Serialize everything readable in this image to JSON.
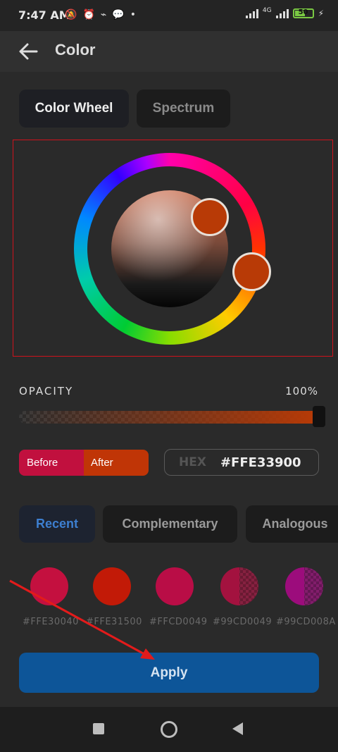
{
  "status_bar": {
    "time": "7:47 AM",
    "network_label": "4G",
    "battery": "50"
  },
  "app_bar": {
    "title": "Color"
  },
  "mode_tabs": [
    {
      "label": "Color Wheel",
      "selected": true
    },
    {
      "label": "Spectrum",
      "selected": false
    }
  ],
  "picker": {
    "selected_color": "#b83a06"
  },
  "opacity": {
    "label": "OPACITY",
    "value_text": "100%",
    "value": 1.0
  },
  "compare": {
    "before_label": "Before",
    "after_label": "After",
    "before_color": "#c1103e",
    "after_color": "#c03506"
  },
  "hex": {
    "label": "HEX",
    "value": "#FFE33900"
  },
  "swatch_tabs": [
    {
      "label": "Recent",
      "selected": true
    },
    {
      "label": "Complementary",
      "selected": false
    },
    {
      "label": "Analogous",
      "selected": false
    }
  ],
  "swatches": [
    {
      "label": "#FFE30040",
      "color": "#c4103f"
    },
    {
      "label": "#FFE31500",
      "color": "#c21a07"
    },
    {
      "label": "#FFCD0049",
      "color": "#b90d46"
    },
    {
      "label": "#99CD0049",
      "color": "#a3123f"
    },
    {
      "label": "#99CD008A",
      "color": "#9c0c7c"
    }
  ],
  "apply_label": "Apply",
  "colors": {
    "accent": "#0d5598",
    "frame_highlight": "#d0121c"
  }
}
